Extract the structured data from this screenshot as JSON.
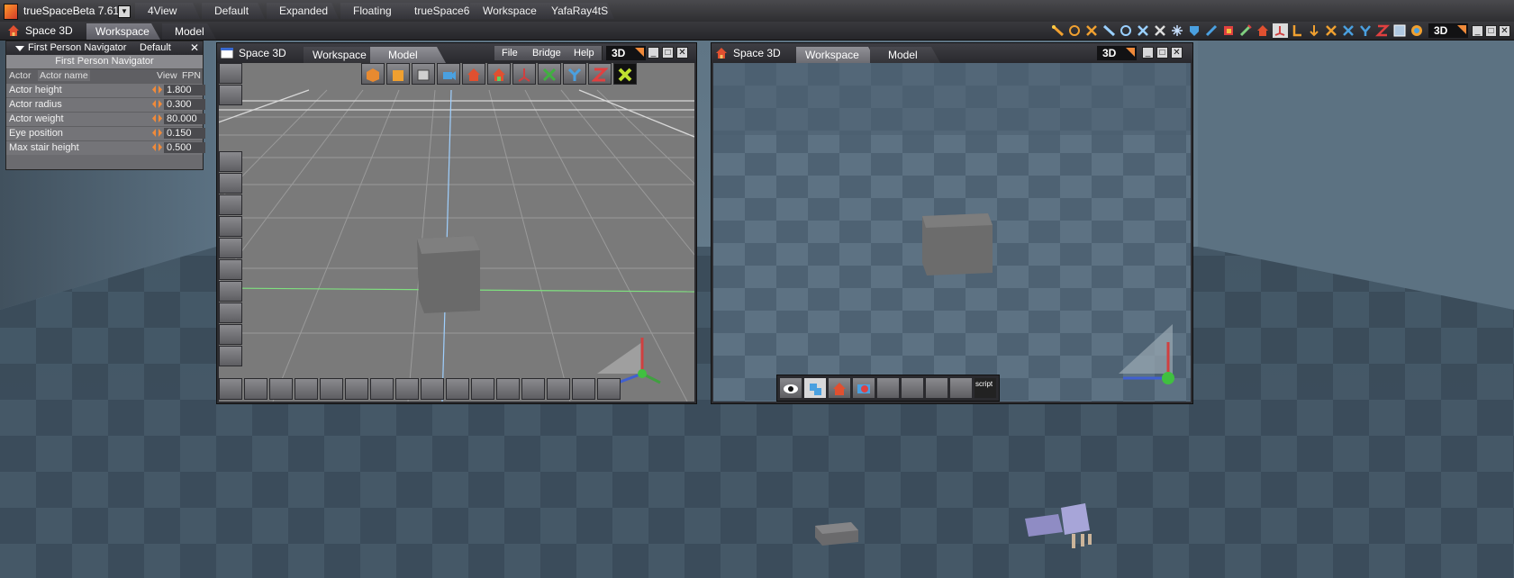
{
  "app": {
    "title": "trueSpaceBeta 7.61",
    "layouts": [
      "4View",
      "Default",
      "Expanded",
      "Floating",
      "trueSpace6",
      "Workspace",
      "YafaRay4tS"
    ]
  },
  "space_bar": {
    "label": "Space 3D",
    "tabs": [
      "Workspace",
      "Model"
    ],
    "badge": "3D"
  },
  "fpn_panel": {
    "title": "First Person Navigator",
    "preset": "Default",
    "close": "✕",
    "subtitle": "First Person Navigator",
    "columns": {
      "actor": "Actor",
      "actor_name": "Actor name",
      "view": "View",
      "fpn": "FPN"
    },
    "rows": [
      {
        "label": "Actor height",
        "value": "1.800"
      },
      {
        "label": "Actor radius",
        "value": "0.300"
      },
      {
        "label": "Actor weight",
        "value": "80.000"
      },
      {
        "label": "Eye position",
        "value": "0.150"
      },
      {
        "label": "Max stair height",
        "value": "0.500"
      }
    ]
  },
  "model_window": {
    "title": "Space 3D",
    "tabs": [
      "Workspace",
      "Model"
    ],
    "menus": [
      "File",
      "Bridge",
      "Help"
    ],
    "badge": "3D",
    "axes": [
      "X",
      "Y",
      "Z"
    ]
  },
  "workspace_window": {
    "title": "Space 3D",
    "tabs": [
      "Workspace",
      "Model"
    ],
    "badge": "3D",
    "script_label": "script"
  },
  "colors": {
    "accent_orange": "#f08a3a",
    "grid_blue": "#9fd0ff",
    "grid_green": "#7fe07f",
    "floor_dark": "#3e4f5e",
    "floor_light": "#4f6373"
  }
}
